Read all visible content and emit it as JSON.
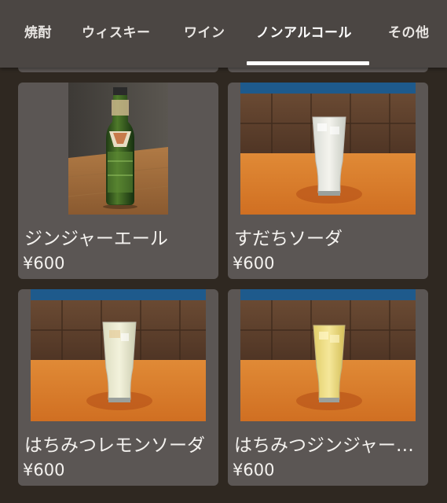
{
  "tabs": [
    {
      "label": "焼酎",
      "active": false
    },
    {
      "label": "ウィスキー",
      "active": false
    },
    {
      "label": "ワイン",
      "active": false
    },
    {
      "label": "ノンアルコール",
      "active": true
    },
    {
      "label": "その他",
      "active": false
    }
  ],
  "products": [
    {
      "name": "ジンジャーエール",
      "price": "¥600",
      "photo": "ginger-ale-bottle-photo"
    },
    {
      "name": "すだちソーダ",
      "price": "¥600",
      "photo": "sudachi-soda-glass-photo"
    },
    {
      "name": "はちみつレモンソーダ",
      "price": "¥600",
      "photo": "honey-lemon-soda-glass-photo"
    },
    {
      "name": "はちみつジンジャーソーダ",
      "price": "¥600",
      "photo": "honey-ginger-soda-glass-photo"
    }
  ],
  "colors": {
    "background": "#2f2821",
    "tabbar": "#4b4643",
    "card": "#5b5654",
    "text": "#f4f2ef",
    "active_indicator": "#ffffff"
  }
}
